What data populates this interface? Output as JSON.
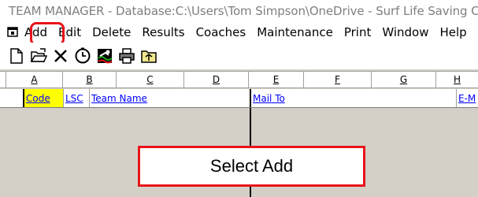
{
  "window": {
    "title": "TEAM MANAGER - Database:C:\\Users\\Tom Simpson\\OneDrive - Surf Life Saving Cer",
    "icon": "team-manager-app-icon"
  },
  "menu": {
    "items": [
      "Add",
      "Edit",
      "Delete",
      "Results",
      "Coaches",
      "Maintenance",
      "Print",
      "Window",
      "Help"
    ]
  },
  "toolbar": {
    "icons": [
      "new-document-icon",
      "open-folder-icon",
      "delete-x-icon",
      "clock-icon",
      "swimmer-icon",
      "printer-icon",
      "folder-up-icon"
    ]
  },
  "grid": {
    "column_letters": [
      "A",
      "B",
      "C",
      "D",
      "E",
      "F",
      "G",
      "H"
    ],
    "headers": {
      "code": "Code",
      "lsc": "LSC",
      "team_name": "Team Name",
      "mail_to": "Mail To",
      "email": "E-M"
    }
  },
  "callout": {
    "text": "Select Add"
  },
  "colors": {
    "highlight_red": "#e8141a",
    "code_header_bg": "#ffff00",
    "header_link": "#0000ff",
    "grid_bg": "#d4d0c8"
  }
}
